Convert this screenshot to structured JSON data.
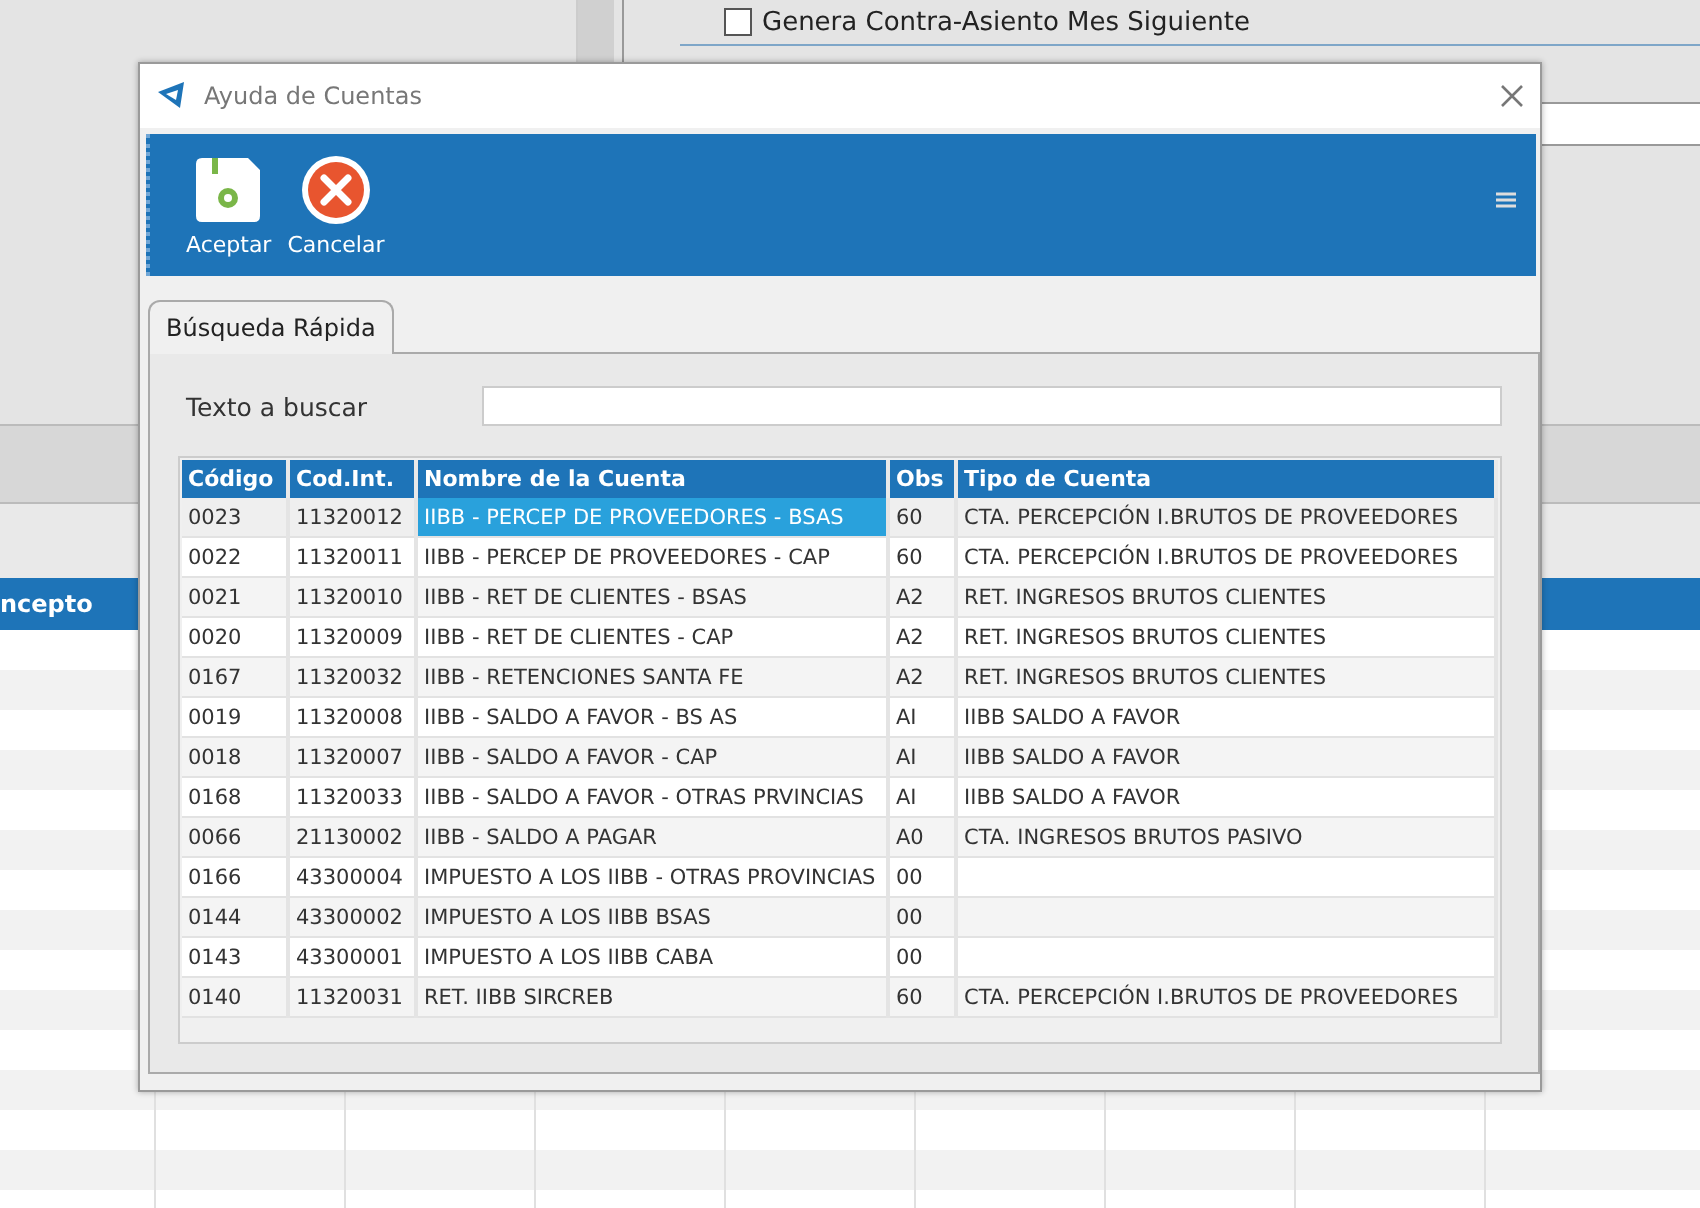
{
  "background": {
    "checkbox": {
      "label": "Genera Contra-Asiento Mes Siguiente",
      "checked": false
    },
    "grid_header": "ncepto"
  },
  "window": {
    "title": "Ayuda de Cuentas"
  },
  "toolbar": {
    "buttons": [
      {
        "label": "Aceptar",
        "kind": "save"
      },
      {
        "label": "Cancelar",
        "kind": "cancel"
      }
    ]
  },
  "tabs": [
    {
      "label": "Búsqueda Rápida",
      "selected": true
    }
  ],
  "search": {
    "label": "Texto a buscar"
  },
  "table": {
    "columns": [
      {
        "label": "Código",
        "kind": "code"
      },
      {
        "label": "Cod.Int.",
        "kind": "code"
      },
      {
        "label": "Nombre de la Cuenta",
        "kind": "name"
      },
      {
        "label": "Obs",
        "kind": "code"
      },
      {
        "label": "Tipo de Cuenta",
        "kind": "type"
      }
    ],
    "rows": [
      {
        "cells": [
          "0023",
          "11320012",
          "IIBB - PERCEP DE PROVEEDORES - BSAS",
          "60",
          "CTA. PERCEPCIÓN I.BRUTOS DE PROVEEDORES"
        ],
        "selected": true
      },
      {
        "cells": [
          "0022",
          "11320011",
          "IIBB - PERCEP DE PROVEEDORES - CAP",
          "60",
          "CTA. PERCEPCIÓN I.BRUTOS DE PROVEEDORES"
        ],
        "selected": false
      },
      {
        "cells": [
          "0021",
          "11320010",
          "IIBB - RET DE CLIENTES - BSAS",
          "A2",
          "RET. INGRESOS BRUTOS CLIENTES"
        ],
        "selected": false
      },
      {
        "cells": [
          "0020",
          "11320009",
          "IIBB - RET DE CLIENTES - CAP",
          "A2",
          "RET. INGRESOS BRUTOS CLIENTES"
        ],
        "selected": false
      },
      {
        "cells": [
          "0167",
          "11320032",
          "IIBB - RETENCIONES SANTA FE",
          "A2",
          "RET. INGRESOS BRUTOS CLIENTES"
        ],
        "selected": false
      },
      {
        "cells": [
          "0019",
          "11320008",
          "IIBB - SALDO A FAVOR - BS AS",
          "AI",
          "IIBB SALDO A FAVOR"
        ],
        "selected": false
      },
      {
        "cells": [
          "0018",
          "11320007",
          "IIBB - SALDO A FAVOR - CAP",
          "AI",
          "IIBB SALDO A FAVOR"
        ],
        "selected": false
      },
      {
        "cells": [
          "0168",
          "11320033",
          "IIBB - SALDO A FAVOR - OTRAS PRVINCIAS",
          "AI",
          "IIBB SALDO A FAVOR"
        ],
        "selected": false
      },
      {
        "cells": [
          "0066",
          "21130002",
          "IIBB - SALDO A PAGAR",
          "A0",
          "CTA. INGRESOS BRUTOS PASIVO"
        ],
        "selected": false
      },
      {
        "cells": [
          "0166",
          "43300004",
          "IMPUESTO A LOS IIBB - OTRAS PROVINCIAS",
          "00",
          ""
        ],
        "selected": false
      },
      {
        "cells": [
          "0144",
          "43300002",
          "IMPUESTO A LOS IIBB BSAS",
          "00",
          ""
        ],
        "selected": false
      },
      {
        "cells": [
          "0143",
          "43300001",
          "IMPUESTO A LOS IIBB CABA",
          "00",
          ""
        ],
        "selected": false
      },
      {
        "cells": [
          "0140",
          "11320031",
          "RET. IIBB SIRCREB",
          "60",
          "CTA. PERCEPCIÓN I.BRUTOS DE PROVEEDORES"
        ],
        "selected": false
      }
    ]
  }
}
